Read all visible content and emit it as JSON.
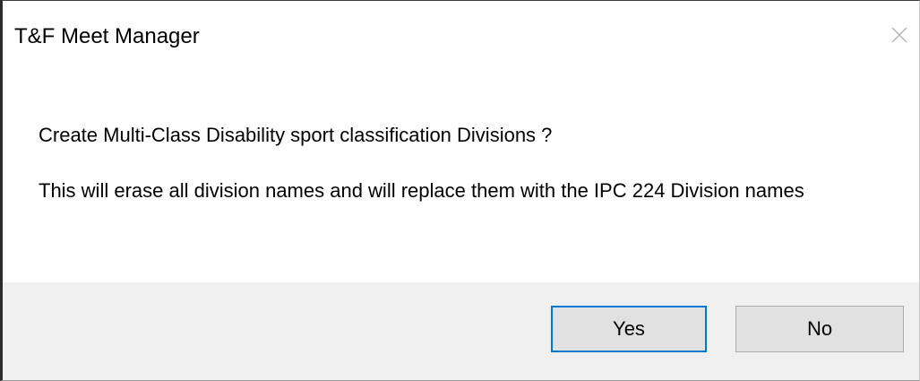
{
  "window": {
    "title": "T&F Meet Manager",
    "close_icon": "close-icon"
  },
  "message": {
    "line1": "Create Multi-Class Disability sport classification Divisions ?",
    "line2": "This will erase all division names and will replace them with the IPC 224 Division names"
  },
  "buttons": {
    "yes_label": "Yes",
    "no_label": "No",
    "default": "Yes"
  },
  "colors": {
    "footer_bg": "#f0f0f0",
    "button_bg": "#e1e1e1",
    "focus_border": "#0078d7"
  }
}
